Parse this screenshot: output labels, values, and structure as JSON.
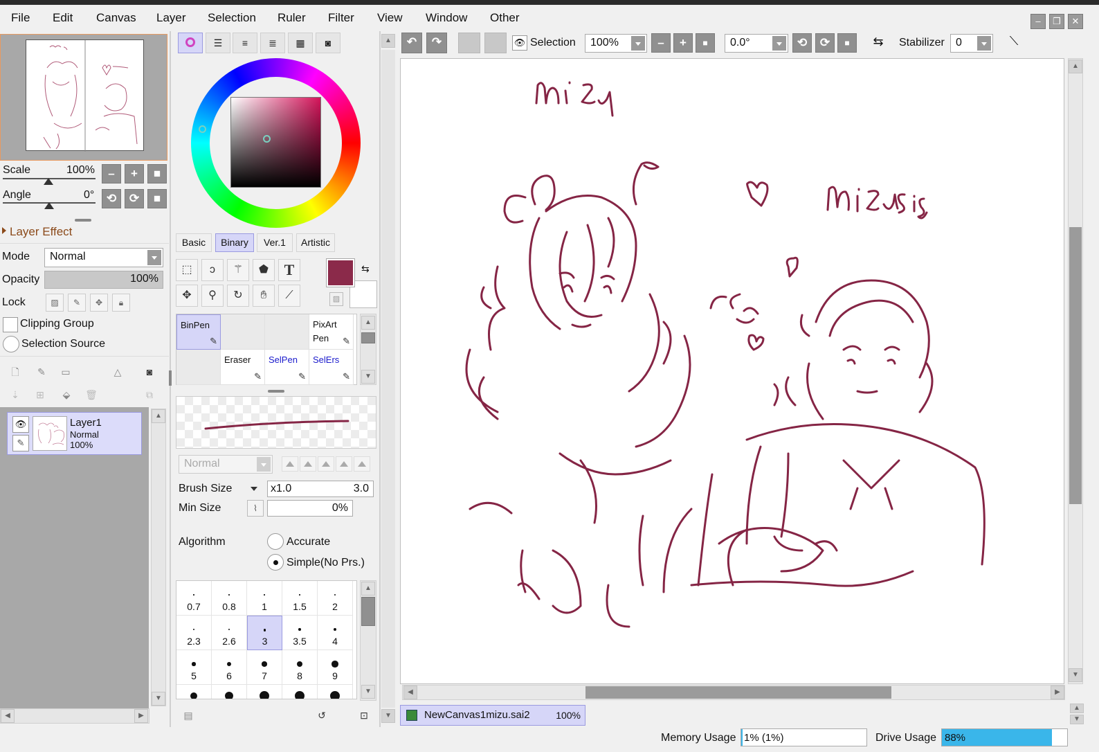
{
  "menu": [
    "File",
    "Edit",
    "Canvas",
    "Layer",
    "Selection",
    "Ruler",
    "Filter",
    "View",
    "Window",
    "Other"
  ],
  "menu_underline": [
    "F",
    "E",
    "C",
    "L",
    "S",
    "R",
    "t",
    "V",
    "W",
    "O"
  ],
  "navigator": {
    "scale_label": "Scale",
    "scale_value": "100%",
    "angle_label": "Angle",
    "angle_value": "0°"
  },
  "layer_effect": {
    "header": "Layer Effect",
    "mode_label": "Mode",
    "mode_value": "Normal",
    "opacity_label": "Opacity",
    "opacity_value": "100%",
    "lock_label": "Lock",
    "clipping_group_label": "Clipping Group",
    "selection_source_label": "Selection Source"
  },
  "layers": [
    {
      "name": "Layer1",
      "mode": "Normal",
      "opacity": "100%"
    }
  ],
  "color_tabs": [
    "Basic",
    "Binary",
    "Ver.1",
    "Artistic"
  ],
  "active_color_tab": "Binary",
  "colors": {
    "primary": "#8b2a4a",
    "secondary": "#ffffff",
    "stroke": "#852545",
    "accent_active": "#d6d6f8"
  },
  "brushes": [
    {
      "name": "BinPen",
      "color": "#111111",
      "active": true
    },
    {
      "name": "",
      "color": "#111111"
    },
    {
      "name": "",
      "color": "#111111"
    },
    {
      "name": "PixArt Pen",
      "color": "#111111"
    },
    {
      "name": "",
      "color": "#111111"
    },
    {
      "name": "Eraser",
      "color": "#111111"
    },
    {
      "name": "SelPen",
      "color": "#1a1acc"
    },
    {
      "name": "SelErs",
      "color": "#1a1acc"
    }
  ],
  "brush_settings": {
    "blend_mode": "Normal",
    "brush_size_label": "Brush Size",
    "brush_size_multiplier": "x1.0",
    "brush_size_value": "3.0",
    "min_size_label": "Min Size",
    "min_size_value": "0%",
    "algorithm_label": "Algorithm",
    "algorithm_options": [
      "Accurate",
      "Simple(No Prs.)"
    ],
    "algorithm_selected": "Simple(No Prs.)"
  },
  "brush_sizes": [
    "0.7",
    "0.8",
    "1",
    "1.5",
    "2",
    "2.3",
    "2.6",
    "3",
    "3.5",
    "4",
    "5",
    "6",
    "7",
    "8",
    "9"
  ],
  "brush_size_selected": "3",
  "canvas_toolbar": {
    "selection_label": "Selection",
    "zoom_value": "100%",
    "rotation_value": "0.0°",
    "stabilizer_label": "Stabilizer",
    "stabilizer_value": "0"
  },
  "document_tab": {
    "name": "NewCanvas1mizu.sai2",
    "zoom": "100%"
  },
  "status": {
    "memory_label": "Memory Usage",
    "memory_value": "1% (1%)",
    "memory_fraction": 0.01,
    "drive_label": "Drive Usage",
    "drive_value": "88%",
    "drive_fraction": 0.88
  },
  "icons": [
    "undo-icon",
    "redo-icon",
    "eye-icon",
    "minus-icon",
    "plus-icon",
    "reset-icon",
    "rotate-left-icon",
    "rotate-right-icon",
    "flip-icon",
    "line-icon",
    "color-wheel-icon",
    "rectangle-select-icon",
    "lasso-icon",
    "magic-wand-icon",
    "fill-shape-icon",
    "text-icon",
    "move-icon",
    "zoom-icon",
    "rotate-icon",
    "hand-icon",
    "eyedropper-icon",
    "swap-colors-icon",
    "new-layer-icon",
    "trash-icon"
  ]
}
